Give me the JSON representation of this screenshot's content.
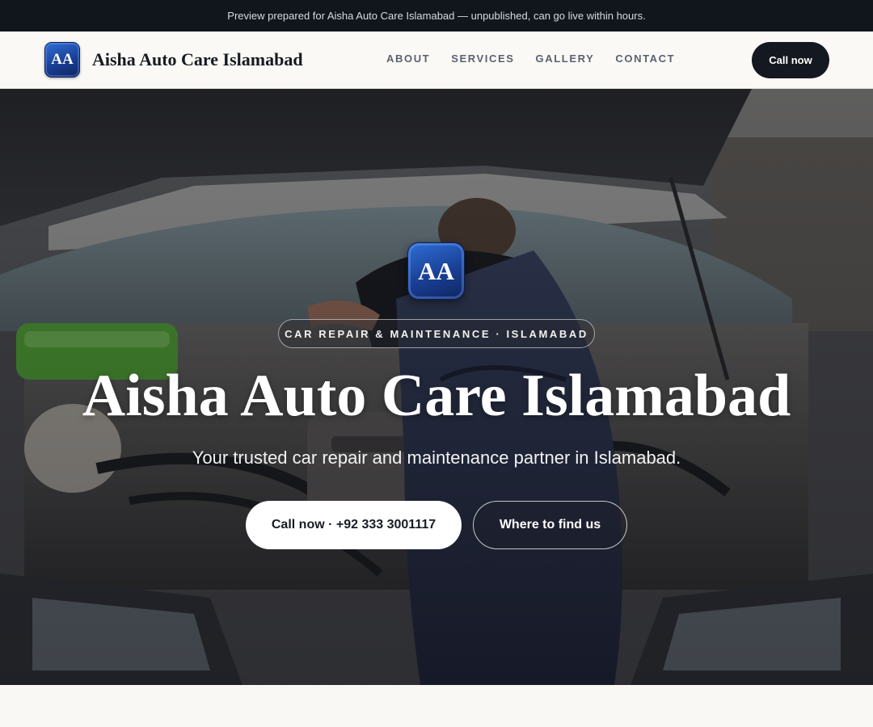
{
  "preview_bar": {
    "text": "Preview prepared for Aisha Auto Care Islamabad — unpublished, can go live within hours."
  },
  "header": {
    "logo_initials": "AA",
    "brand_name": "Aisha Auto Care Islamabad",
    "nav": [
      {
        "label": "ABOUT"
      },
      {
        "label": "SERVICES"
      },
      {
        "label": "GALLERY"
      },
      {
        "label": "CONTACT"
      }
    ],
    "cta_label": "Call now"
  },
  "hero": {
    "background_image": "mechanic-working-under-car-hood",
    "badge_initials": "AA",
    "eyebrow": "CAR REPAIR & MAINTENANCE · ISLAMABAD",
    "title": "Aisha Auto Care Islamabad",
    "subtitle": "Your trusted car repair and maintenance partner in Islamabad.",
    "primary_button": "Call now · +92 333 3001117",
    "secondary_button": "Where to find us"
  },
  "colors": {
    "dark": "#11151c",
    "accent_blue": "#1a3f95",
    "page_bg": "#f9f8f5",
    "white": "#ffffff"
  }
}
